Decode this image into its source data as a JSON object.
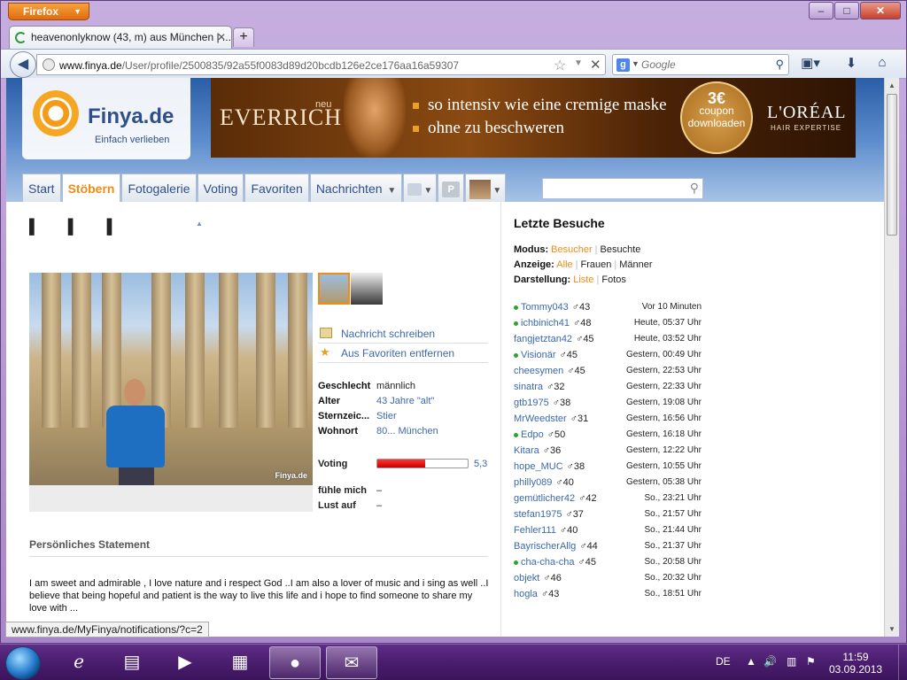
{
  "browser": {
    "app_button": "Firefox",
    "tab_title": "heavenonlyknow (43, m) aus München | ...",
    "url_host": "www.finya.de",
    "url_path": "/User/profile/2500835/92a55f0083d89d20bcdb126e2ce176aa16a59307",
    "search_placeholder": "Google",
    "status_url": "www.finya.de/MyFinya/notifications/?c=2"
  },
  "site": {
    "logo": "Finya.de",
    "tagline": "Einfach verlieben",
    "menu": [
      "Start",
      "Stöbern",
      "Fotogalerie",
      "Voting",
      "Favoriten",
      "Nachrichten"
    ],
    "active_menu": "Stöbern"
  },
  "ad": {
    "neu": "neu",
    "brand": "EVERRICH",
    "line1": "so intensiv wie eine cremige maske",
    "line2": "ohne zu beschweren",
    "coupon_big": "3€",
    "coupon_l1": "coupon",
    "coupon_l2": "downloaden",
    "sponsor": "L'ORÉAL",
    "sponsor_sub": "HAIR EXPERTISE"
  },
  "profile": {
    "photo_stamp": "Finya.de",
    "actions": {
      "message": "Nachricht schreiben",
      "unfavorite": "Aus Favoriten entfernen"
    },
    "facts": [
      {
        "key": "Geschlecht",
        "value": "männlich"
      },
      {
        "key": "Alter",
        "value": "43 Jahre \"alt\""
      },
      {
        "key": "Sternzeic...",
        "value": "Stier"
      },
      {
        "key": "Wohnort",
        "value": "80... München"
      }
    ],
    "voting_label": "Voting",
    "voting_value": "5,3",
    "voting_fill": 0.53,
    "mood": [
      {
        "key": "fühle mich",
        "value": "–"
      },
      {
        "key": "Lust auf",
        "value": "–"
      }
    ],
    "statement_heading": "Persönliches Statement",
    "statement_text": "I am sweet and admirable , I love nature and i respect God ..I am also a lover of music and i sing as well ..I believe that being hopeful and patient is the way to live this life and i hope to find someone to share my love with ..."
  },
  "visits_panel": {
    "title": "Letzte Besuche",
    "modus_label": "Modus:",
    "modus_options": [
      "Besucher",
      "Besuchte"
    ],
    "anzeige_label": "Anzeige:",
    "anzeige_options": [
      "Alle",
      "Frauen",
      "Männer"
    ],
    "darstellung_label": "Darstellung:",
    "darstellung_options": [
      "Liste",
      "Fotos"
    ],
    "visits": [
      {
        "name": "Tommy043",
        "age": "♂43",
        "when": "Vor 10 Minuten",
        "online": true
      },
      {
        "name": "ichbinich41",
        "age": "♂48",
        "when": "Heute, 05:37 Uhr",
        "online": true
      },
      {
        "name": "fangjetztan42",
        "age": "♂45",
        "when": "Heute, 03:52 Uhr",
        "online": false
      },
      {
        "name": "Visionär",
        "age": "♂45",
        "when": "Gestern, 00:49 Uhr",
        "online": true
      },
      {
        "name": "cheesymen",
        "age": "♂45",
        "when": "Gestern, 22:53 Uhr",
        "online": false
      },
      {
        "name": "sinatra",
        "age": "♂32",
        "when": "Gestern, 22:33 Uhr",
        "online": false
      },
      {
        "name": "gtb1975",
        "age": "♂38",
        "when": "Gestern, 19:08 Uhr",
        "online": false
      },
      {
        "name": "MrWeedster",
        "age": "♂31",
        "when": "Gestern, 16:56 Uhr",
        "online": false
      },
      {
        "name": "Edpo",
        "age": "♂50",
        "when": "Gestern, 16:18 Uhr",
        "online": true
      },
      {
        "name": "Kitara",
        "age": "♂36",
        "when": "Gestern, 12:22 Uhr",
        "online": false
      },
      {
        "name": "hope_MUC",
        "age": "♂38",
        "when": "Gestern, 10:55 Uhr",
        "online": false
      },
      {
        "name": "philly089",
        "age": "♂40",
        "when": "Gestern, 05:38 Uhr",
        "online": false
      },
      {
        "name": "gemütlicher42",
        "age": "♂42",
        "when": "So., 23:21 Uhr",
        "online": false
      },
      {
        "name": "stefan1975",
        "age": "♂37",
        "when": "So., 21:57 Uhr",
        "online": false
      },
      {
        "name": "Fehler111",
        "age": "♂40",
        "when": "So., 21:44 Uhr",
        "online": false
      },
      {
        "name": "BayrischerAllg",
        "age": "♂44",
        "when": "So., 21:37 Uhr",
        "online": false
      },
      {
        "name": "cha-cha-cha",
        "age": "♂45",
        "when": "So., 20:58 Uhr",
        "online": true
      },
      {
        "name": "objekt",
        "age": "♂46",
        "when": "So., 20:32 Uhr",
        "online": false
      },
      {
        "name": "hogla",
        "age": "♂43",
        "when": "So., 18:51 Uhr",
        "online": false
      }
    ]
  },
  "taskbar": {
    "lang": "DE",
    "time": "11:59",
    "date": "03.09.2013"
  }
}
